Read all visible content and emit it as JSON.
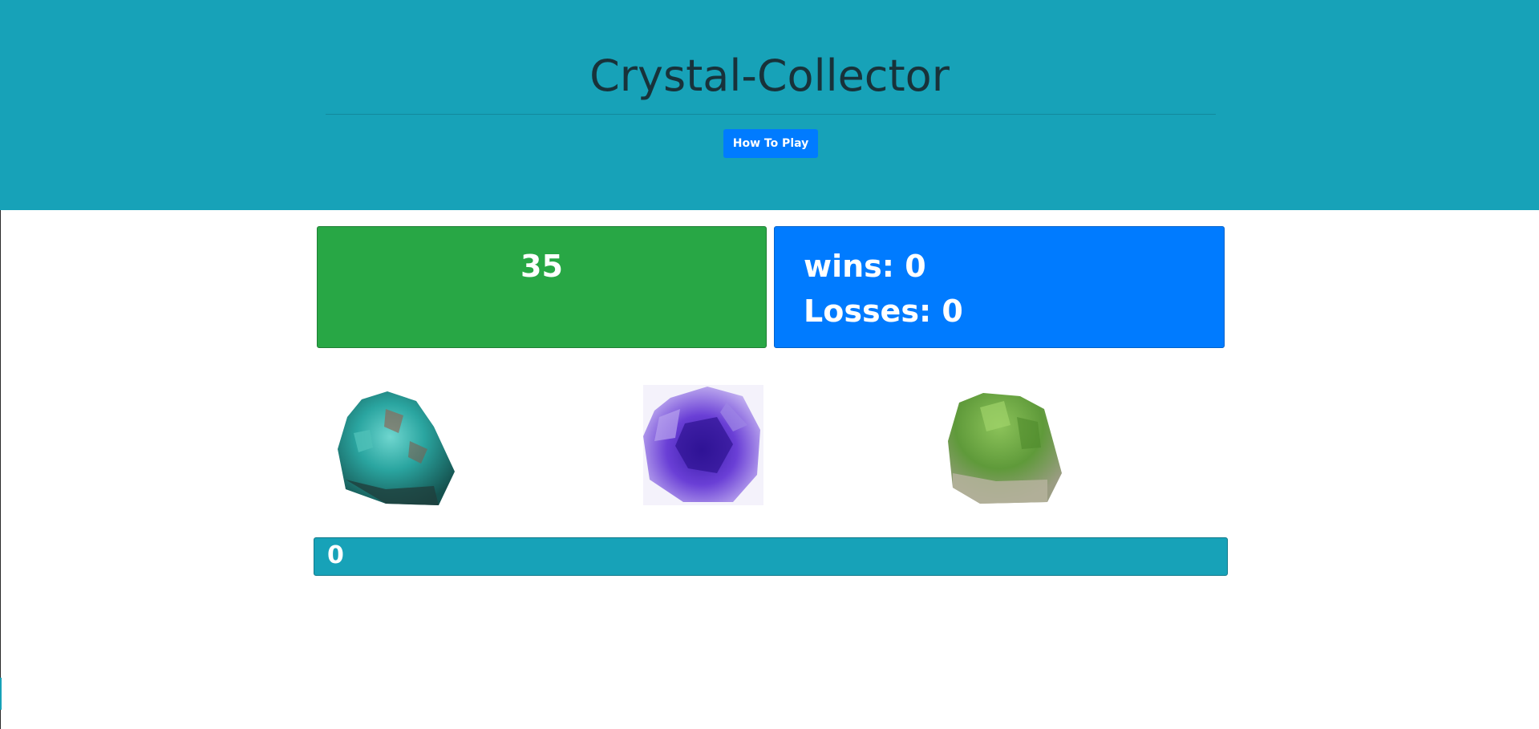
{
  "header": {
    "title": "Crystal-Collector",
    "how_to_play_label": "How To Play"
  },
  "game": {
    "target_number": "35",
    "wins": "wins: 0",
    "losses": "Losses: 0",
    "total_score": "0"
  },
  "crystals": [
    {
      "name": "turquoise-crystal",
      "color": "#2aa5a0"
    },
    {
      "name": "amethyst-crystal",
      "color": "#6a3fd6"
    },
    {
      "name": "peridot-crystal",
      "color": "#5f9a3a"
    }
  ],
  "colors": {
    "header_bg": "#17a2b8",
    "target_bg": "#28a745",
    "score_bg": "#007bff",
    "button_bg": "#007bff",
    "total_bg": "#17a2b8"
  }
}
